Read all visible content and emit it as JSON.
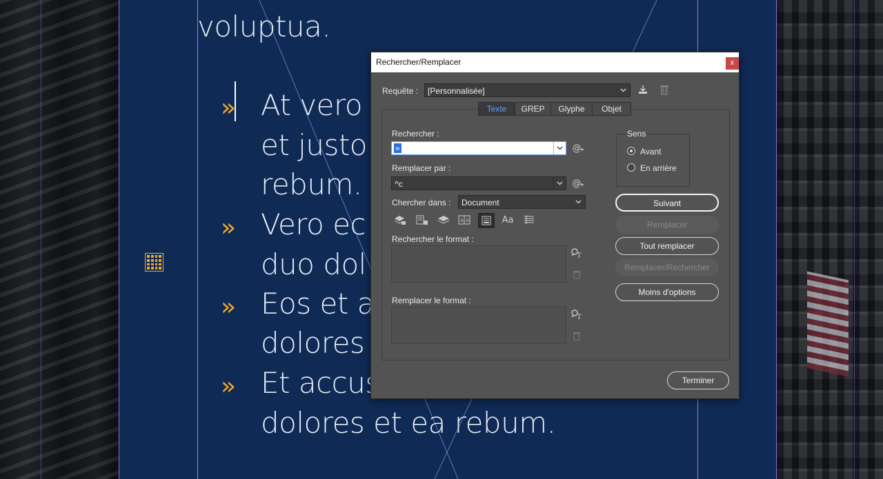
{
  "document": {
    "lines": [
      "voluptua.",
      "At vero",
      "et justo",
      "rebum.",
      "Vero ec",
      "duo dol",
      "Eos et a",
      "dolores",
      "Et accus",
      "dolores et ea rebum."
    ],
    "bullet": "»",
    "bullet_color": "#f2a928",
    "page_color": "#0f2a55"
  },
  "dialog": {
    "title": "Rechercher/Remplacer",
    "close_label": "x",
    "query_label": "Requête :",
    "query_value": "[Personnalisée]",
    "tabs": [
      "Texte",
      "GREP",
      "Glyphe",
      "Objet"
    ],
    "active_tab": "Texte",
    "find_label": "Rechercher :",
    "find_value": "»",
    "replace_label": "Remplacer par :",
    "replace_value": "^c",
    "search_in_label": "Chercher dans :",
    "search_in_value": "Document",
    "find_format_label": "Rechercher le format :",
    "replace_format_label": "Remplacer le format :",
    "direction": {
      "label": "Sens",
      "options": [
        "Avant",
        "En arrière"
      ],
      "selected": "Avant"
    },
    "buttons": {
      "next": "Suivant",
      "replace": "Remplacer",
      "replace_all": "Tout remplacer",
      "replace_find": "Remplacer/Rechercher",
      "fewer_options": "Moins d'options",
      "done": "Terminer"
    },
    "special_char_icon": "@",
    "toggle_icons": [
      "locked-layers-icon",
      "locked-stories-icon",
      "hidden-layers-icon",
      "master-pages-icon",
      "footnotes-icon",
      "case-sensitive-icon",
      "whole-word-icon"
    ],
    "case_label": "Aa"
  }
}
